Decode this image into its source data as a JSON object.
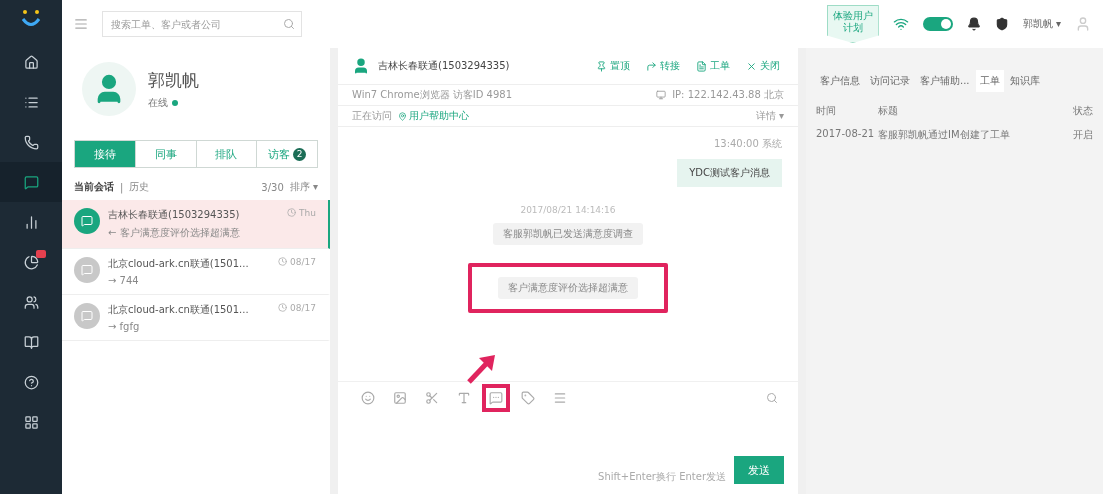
{
  "nav": [
    {
      "selected": false
    },
    {
      "selected": false
    },
    {
      "selected": false
    },
    {
      "selected": true
    },
    {
      "selected": false
    },
    {
      "selected": false,
      "badge": true
    },
    {
      "selected": false
    },
    {
      "selected": false
    },
    {
      "selected": false
    },
    {
      "selected": false
    }
  ],
  "search": {
    "placeholder": "搜索工单、客户或者公司"
  },
  "topbar": {
    "plan_badge": [
      "体验用户",
      "计划"
    ],
    "online": true,
    "user": "郭凯帆 ▾"
  },
  "agent": {
    "name": "郭凯帆",
    "status": "在线"
  },
  "tabs": [
    {
      "label": "接待",
      "selected": true
    },
    {
      "label": "同事",
      "selected": false
    },
    {
      "label": "排队",
      "selected": false
    },
    {
      "label": "访客",
      "selected": false,
      "count": "2"
    }
  ],
  "list_header": {
    "current": "当前会话",
    "separator": "|",
    "history": "历史",
    "count": "3/30",
    "sort": "排序 ▾"
  },
  "sessions": [
    {
      "name": "吉林长春联通(1503294335)",
      "time": "Thu",
      "message": "← 客户满意度评价选择超满意",
      "selected": true,
      "active": true
    },
    {
      "name": "北京cloud-ark.cn联通(1501...",
      "time": "08/17",
      "message": "→ 744",
      "selected": false,
      "active": false
    },
    {
      "name": "北京cloud-ark.cn联通(1501...",
      "time": "08/17",
      "message": "→ fgfg",
      "selected": false,
      "active": false
    }
  ],
  "chat": {
    "visitor": "吉林长春联通(1503294335)",
    "actions": [
      "置顶",
      "转接",
      "工单",
      "关闭"
    ],
    "browser": "Win7 Chrome浏览器 访客ID 4981",
    "ip": "IP: 122.142.43.88 北京",
    "visiting_label": "正在访问",
    "visiting_page": "用户帮助中心",
    "details": "详情 ▾",
    "messages": [
      {
        "kind": "time",
        "text": "13:40:00 系统"
      },
      {
        "kind": "outgoing",
        "text": "YDC测试客户消息"
      },
      {
        "kind": "divider",
        "text": "2017/08/21 14:14:16"
      },
      {
        "kind": "system",
        "text": "客服郭凯帆已发送满意度调查",
        "highlighted": false
      },
      {
        "kind": "system",
        "text": "客户满意度评价选择超满意",
        "highlighted": true
      }
    ],
    "tools": [
      {
        "highlighted": false
      },
      {
        "highlighted": false
      },
      {
        "highlighted": false
      },
      {
        "highlighted": false
      },
      {
        "highlighted": true
      },
      {
        "highlighted": false
      },
      {
        "highlighted": false
      }
    ],
    "hint": "Shift+Enter换行 Enter发送",
    "send": "发送"
  },
  "side_tabs": [
    {
      "label": "客户信息",
      "selected": false
    },
    {
      "label": "访问记录",
      "selected": false
    },
    {
      "label": "客户辅助...",
      "selected": false
    },
    {
      "label": "工单",
      "selected": true
    },
    {
      "label": "知识库",
      "selected": false
    }
  ],
  "tickets": {
    "columns": [
      "时间",
      "标题",
      "状态"
    ],
    "rows": [
      [
        "2017-08-21",
        "客服郭凯帆通过IM创建了工单",
        "开启"
      ]
    ]
  }
}
